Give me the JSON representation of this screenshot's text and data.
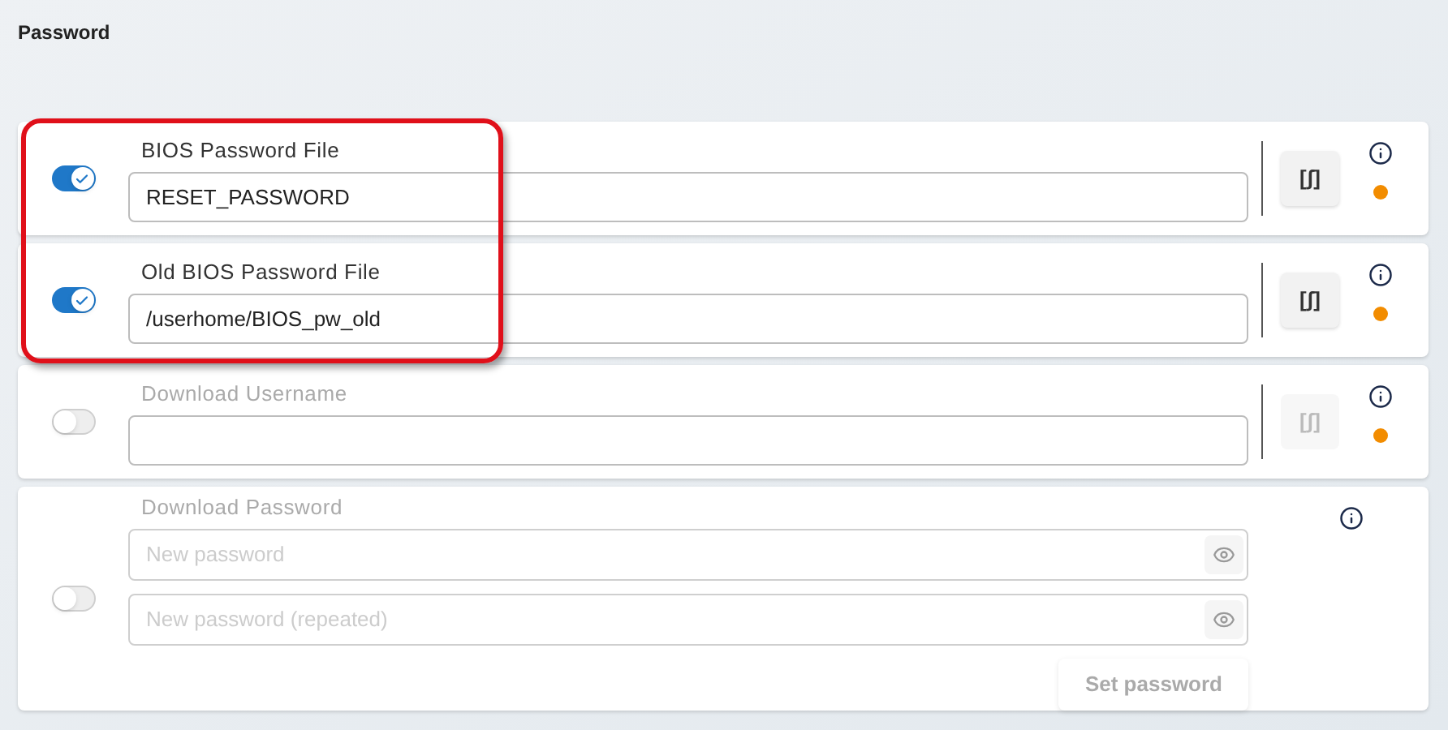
{
  "title": "Password",
  "rows": [
    {
      "kind": "file",
      "label": "BIOS Password File",
      "enabled": true,
      "highlighted": true,
      "value": "RESET_PASSWORD",
      "button": "[ʃ]",
      "warning": true
    },
    {
      "kind": "file",
      "label": "Old BIOS Password File",
      "enabled": true,
      "highlighted": true,
      "value": "/userhome/BIOS_pw_old",
      "button": "[ʃ]",
      "warning": true
    },
    {
      "kind": "file",
      "label": "Download Username",
      "enabled": false,
      "highlighted": false,
      "button": "[ʃ]",
      "warning": true
    },
    {
      "kind": "password",
      "label": "Download Password",
      "enabled": false,
      "highlighted": false,
      "fields": [
        {
          "placeholder": "New password"
        },
        {
          "placeholder": "New password (repeated)"
        }
      ],
      "submit": "Set password"
    }
  ]
}
